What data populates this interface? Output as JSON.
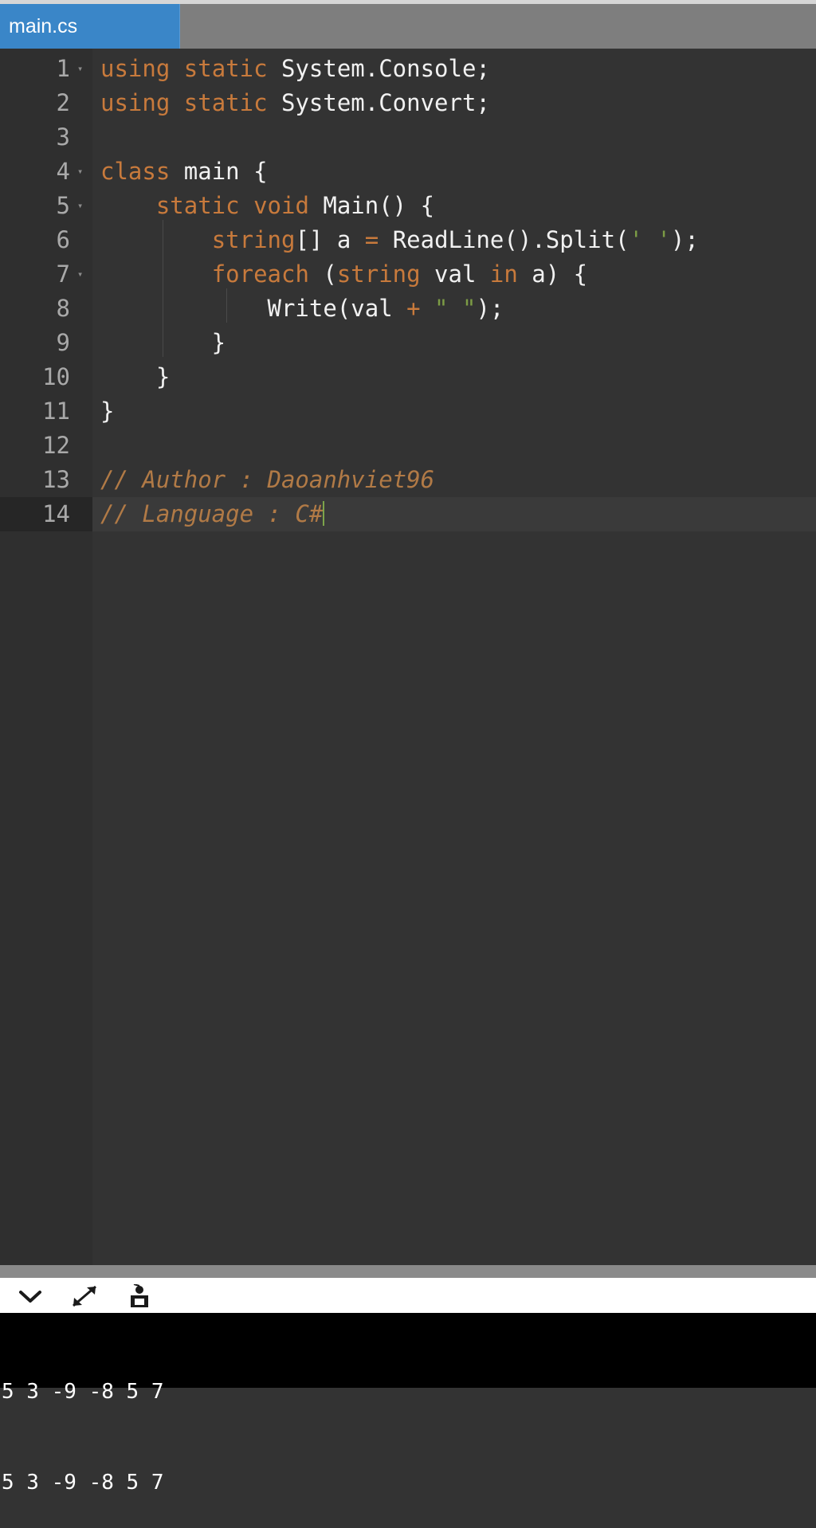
{
  "tab": {
    "label": "main.cs"
  },
  "editor": {
    "lines": [
      {
        "num": "1",
        "fold": "▾",
        "tokens": [
          [
            "kw",
            "using"
          ],
          [
            "t",
            " "
          ],
          [
            "kw",
            "static"
          ],
          [
            "t",
            " System.Console;"
          ]
        ]
      },
      {
        "num": "2",
        "fold": "",
        "tokens": [
          [
            "kw",
            "using"
          ],
          [
            "t",
            " "
          ],
          [
            "kw",
            "static"
          ],
          [
            "t",
            " System.Convert;"
          ]
        ]
      },
      {
        "num": "3",
        "fold": "",
        "tokens": []
      },
      {
        "num": "4",
        "fold": "▾",
        "tokens": [
          [
            "kw",
            "class"
          ],
          [
            "t",
            " main {"
          ]
        ]
      },
      {
        "num": "5",
        "fold": "▾",
        "tokens": [
          [
            "t",
            "    "
          ],
          [
            "kw",
            "static"
          ],
          [
            "t",
            " "
          ],
          [
            "kw",
            "void"
          ],
          [
            "t",
            " Main() {"
          ]
        ]
      },
      {
        "num": "6",
        "fold": "",
        "tokens": [
          [
            "t",
            "        "
          ],
          [
            "kw",
            "string"
          ],
          [
            "t",
            "[] a "
          ],
          [
            "op",
            "="
          ],
          [
            "t",
            " ReadLine().Split("
          ],
          [
            "str",
            "' '"
          ],
          [
            "t",
            ");"
          ]
        ]
      },
      {
        "num": "7",
        "fold": "▾",
        "tokens": [
          [
            "t",
            "        "
          ],
          [
            "kw",
            "foreach"
          ],
          [
            "t",
            " ("
          ],
          [
            "kw",
            "string"
          ],
          [
            "t",
            " val "
          ],
          [
            "kw",
            "in"
          ],
          [
            "t",
            " a) {"
          ]
        ]
      },
      {
        "num": "8",
        "fold": "",
        "tokens": [
          [
            "t",
            "            Write(val "
          ],
          [
            "op",
            "+"
          ],
          [
            "t",
            " "
          ],
          [
            "str",
            "\" \""
          ],
          [
            "t",
            ");"
          ]
        ]
      },
      {
        "num": "9",
        "fold": "",
        "tokens": [
          [
            "t",
            "        }"
          ]
        ]
      },
      {
        "num": "10",
        "fold": "",
        "tokens": [
          [
            "t",
            "    }"
          ]
        ]
      },
      {
        "num": "11",
        "fold": "",
        "tokens": [
          [
            "t",
            "}"
          ]
        ]
      },
      {
        "num": "12",
        "fold": "",
        "tokens": []
      },
      {
        "num": "13",
        "fold": "",
        "tokens": [
          [
            "cm",
            "// Author : Daoanhviet96"
          ]
        ]
      },
      {
        "num": "14",
        "fold": "",
        "tokens": [
          [
            "cm",
            "// Language : C#"
          ]
        ],
        "active": true,
        "caret": true
      }
    ]
  },
  "toolbar": {
    "buttons": [
      {
        "name": "collapse-chevron-icon"
      },
      {
        "name": "expand-arrows-icon"
      },
      {
        "name": "run-save-icon"
      }
    ]
  },
  "console": {
    "lines": [
      "5 3 -9 -8 5 7",
      "5 3 -9 -8 5 7"
    ]
  }
}
